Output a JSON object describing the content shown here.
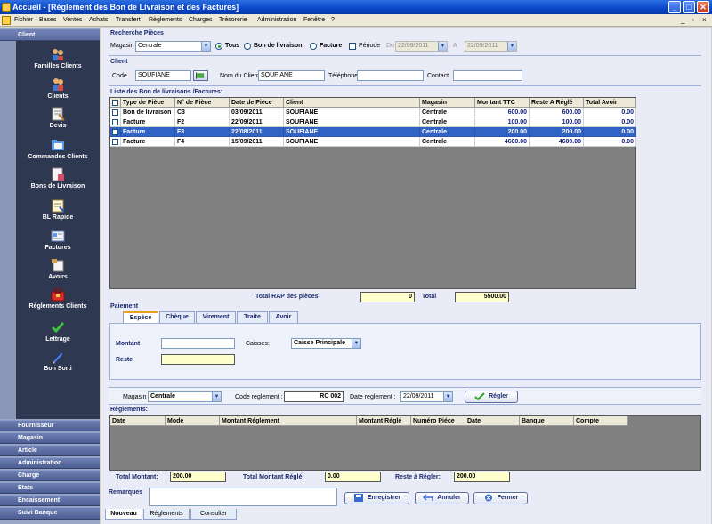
{
  "window": {
    "title": "Accueil - [Réglement des Bon de Livraison et des Factures]",
    "controls": {
      "minimize": "_",
      "maximize": "□",
      "close": "✕"
    },
    "mdi_controls": {
      "minimize": "_",
      "restore": "▫",
      "close": "×"
    }
  },
  "menu": [
    "Fichier",
    "Bases",
    "Ventes",
    "Achats",
    "Transfert",
    "Règlements",
    "Charges",
    "Trésorerie",
    "Administration",
    "Fenêtre",
    "?"
  ],
  "sidebar": {
    "header": "Client",
    "items": [
      {
        "label": "Familles Clients",
        "icon": "people-group-icon"
      },
      {
        "label": "Clients",
        "icon": "users-icon"
      },
      {
        "label": "Devis",
        "icon": "quote-document-icon"
      },
      {
        "label": "Commandes Clients",
        "icon": "order-folder-icon"
      },
      {
        "label": "Bons de Livraison",
        "icon": "delivery-note-icon"
      },
      {
        "label": "BL Rapide",
        "icon": "notepad-icon"
      },
      {
        "label": "Factures",
        "icon": "invoice-icon"
      },
      {
        "label": "Avoirs",
        "icon": "credit-note-icon"
      },
      {
        "label": "Règlements Clients",
        "icon": "toolbox-icon"
      },
      {
        "label": "Lettrage",
        "icon": "checkmark-icon"
      },
      {
        "label": "Bon Sorti",
        "icon": "pencil-icon"
      }
    ],
    "sections": [
      "Fournisseur",
      "Magasin",
      "Article",
      "Administration",
      "Charge",
      "Etats",
      "Encaissement",
      "Suivi Banque"
    ]
  },
  "search": {
    "title": "Recherche Pièces",
    "magasin_label": "Magasin",
    "magasin_value": "Centrale",
    "radio_all": "Tous",
    "radio_bl": "Bon de livraison",
    "radio_facture": "Facture",
    "periode_label": "Période",
    "du_label": "Du",
    "du_value": "22/09/2011",
    "a_label": "A",
    "a_value": "22/09/2011"
  },
  "client": {
    "title": "Client",
    "code_label": "Code",
    "code_value": "SOUFIANE",
    "nom_label": "Nom du Client",
    "nom_value": "SOUFIANE",
    "tel_label": "Téléphone",
    "tel_value": "",
    "contact_label": "Contact",
    "contact_value": ""
  },
  "pieces": {
    "title": "Liste des Bon de livraisons /Factures:",
    "columns": [
      "Type de Pièce",
      "N° de Pièce",
      "Date de Pièce",
      "Client",
      "Magasin",
      "Montant TTC",
      "Reste A Réglé",
      "Total Avoir"
    ],
    "rows": [
      {
        "type": "Bon de livraison",
        "num": "C3",
        "date": "03/09/2011",
        "client": "SOUFIANE",
        "magasin": "Centrale",
        "ttc": "600.00",
        "reste": "600.00",
        "avoir": "0.00",
        "selected": false
      },
      {
        "type": "Facture",
        "num": "F2",
        "date": "22/09/2011",
        "client": "SOUFIANE",
        "magasin": "Centrale",
        "ttc": "100.00",
        "reste": "100.00",
        "avoir": "0.00",
        "selected": false
      },
      {
        "type": "Facture",
        "num": "F3",
        "date": "22/08/2011",
        "client": "SOUFIANE",
        "magasin": "Centrale",
        "ttc": "200.00",
        "reste": "200.00",
        "avoir": "0.00",
        "selected": true
      },
      {
        "type": "Facture",
        "num": "F4",
        "date": "15/09/2011",
        "client": "SOUFIANE",
        "magasin": "Centrale",
        "ttc": "4600.00",
        "reste": "4600.00",
        "avoir": "0.00",
        "selected": false
      }
    ],
    "total_rap_label": "Total  RAP des pièces",
    "total_rap_value": "0",
    "total_label": "Total",
    "total_value": "5500.00"
  },
  "paiement": {
    "title": "Paiement",
    "tabs": [
      "Espèce",
      "Chèque",
      "Virement",
      "Traite",
      "Avoir"
    ],
    "montant_label": "Montant",
    "montant_value": "",
    "reste_label": "Reste",
    "reste_value": "",
    "caisses_label": "Caisses:",
    "caisses_value": "Caisse Principale"
  },
  "reglement_form": {
    "magasin_label": "Magasin",
    "magasin_value": "Centrale",
    "code_label": "Code reglement :",
    "code_value": "RC 002",
    "date_label": "Date reglement :",
    "date_value": "22/09/2011",
    "regler_label": "Régler"
  },
  "reglements": {
    "title": "Règlements:",
    "columns": [
      "Date",
      "Mode",
      "Montant Réglement",
      "Montant Réglé",
      "Numéro Piéce",
      "Date",
      "Banque",
      "Compte"
    ]
  },
  "totals": {
    "montant_label": "Total Montant:",
    "montant_value": "200.00",
    "regle_label": "Total Montant Réglé:",
    "regle_value": "0.00",
    "reste_label": "Reste à Régler:",
    "reste_value": "200.00"
  },
  "remarques": {
    "label": "Remarques",
    "value": ""
  },
  "actions": {
    "save": "Enregistrer",
    "cancel": "Annuler",
    "close": "Fermer"
  },
  "bottom_tabs": [
    "Nouveau",
    "Réglements",
    "Consulter"
  ]
}
